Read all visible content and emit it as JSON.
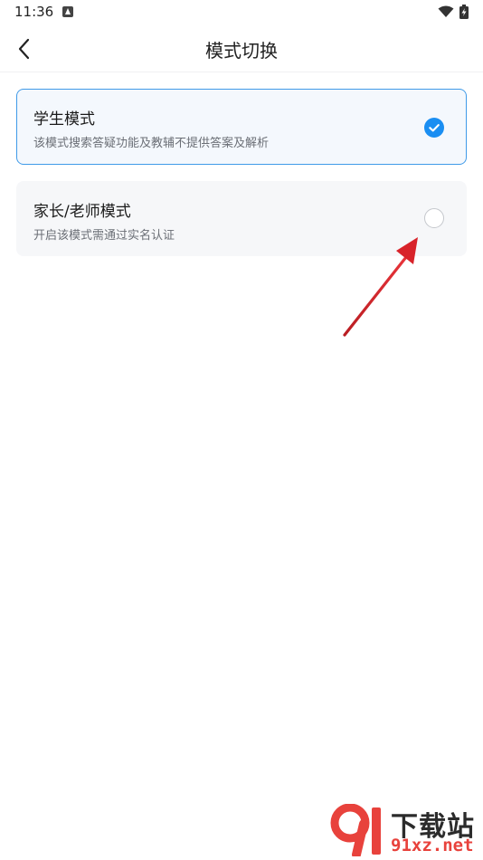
{
  "status_bar": {
    "time": "11:36",
    "icons": [
      "app-notification-icon",
      "wifi-icon",
      "battery-charging-icon"
    ]
  },
  "header": {
    "title": "模式切换",
    "back_icon": "chevron-left-icon"
  },
  "modes": [
    {
      "title": "学生模式",
      "description": "该模式搜索答疑功能及教辅不提供答案及解析",
      "selected": true
    },
    {
      "title": "家长/老师模式",
      "description": "开启该模式需通过实名认证",
      "selected": false
    }
  ],
  "colors": {
    "accent": "#1a8ef2",
    "selected_border": "#3f9ae8",
    "selected_bg": "#f4f8fd",
    "card_bg": "#f6f7f9",
    "annotation_arrow": "#d8232a"
  },
  "watermark": {
    "brand": "下载站",
    "domain": "91xz.net"
  }
}
